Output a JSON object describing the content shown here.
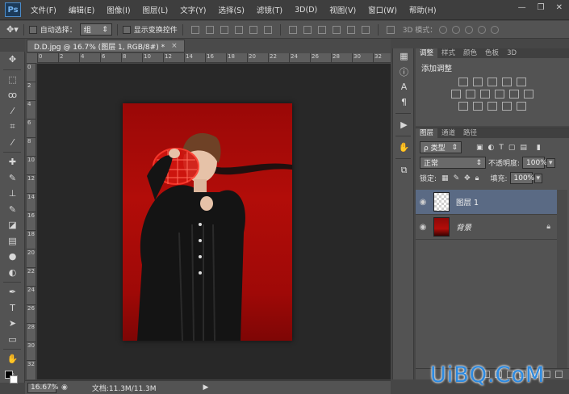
{
  "app": {
    "logo": "Ps"
  },
  "menu": [
    "文件(F)",
    "编辑(E)",
    "图像(I)",
    "图层(L)",
    "文字(Y)",
    "选择(S)",
    "滤镜(T)",
    "3D(D)",
    "视图(V)",
    "窗口(W)",
    "帮助(H)"
  ],
  "window_controls": {
    "minimize": "—",
    "restore": "❐",
    "close": "✕"
  },
  "options": {
    "auto_select_label": "自动选择：",
    "group_value": "组",
    "show_transform_label": "显示变换控件",
    "mode_3d_label": "3D 模式："
  },
  "document": {
    "tab_title": "D.D.jpg @ 16.7% (图层 1, RGB/8#) *",
    "close": "×"
  },
  "ruler_h": [
    "0",
    "2",
    "4",
    "6",
    "8",
    "10",
    "12",
    "14",
    "16",
    "18",
    "20",
    "22",
    "24",
    "26",
    "28",
    "30",
    "32"
  ],
  "ruler_v": [
    "0",
    "2",
    "4",
    "6",
    "8",
    "10",
    "12",
    "14",
    "16",
    "18",
    "20",
    "22",
    "24",
    "26",
    "28",
    "30",
    "32"
  ],
  "status": {
    "zoom": "16.67%",
    "doc_info": "文档:11.3M/11.3M"
  },
  "adjustments": {
    "tabs": [
      "调整",
      "样式",
      "颜色",
      "色板",
      "3D"
    ],
    "title": "添加调整"
  },
  "layers": {
    "tabs": [
      "图层",
      "通道",
      "路径"
    ],
    "filter_type": "ρ 类型",
    "blend_mode": "正常",
    "opacity_label": "不透明度:",
    "opacity_value": "100%",
    "lock_label": "锁定:",
    "fill_label": "填充:",
    "fill_value": "100%",
    "items": [
      {
        "name": "图层 1",
        "selected": true
      },
      {
        "name": "背景",
        "selected": false
      }
    ]
  },
  "watermark": "UiBQ.CoM"
}
